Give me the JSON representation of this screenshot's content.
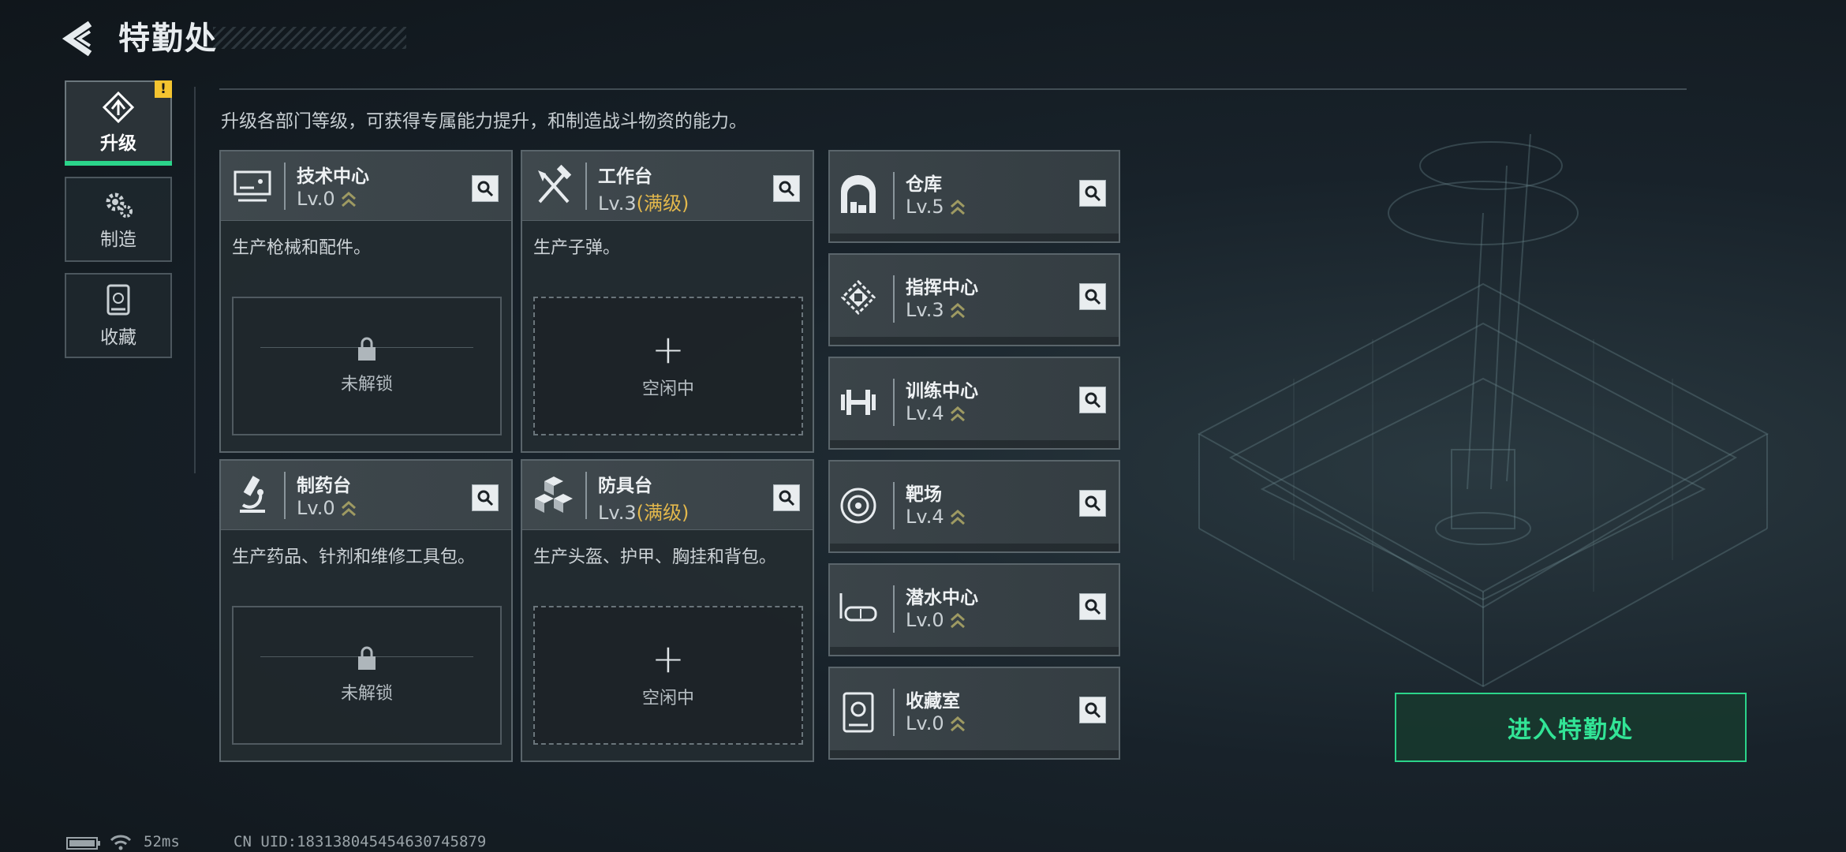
{
  "header": {
    "title": "特勤处"
  },
  "sidebar": {
    "items": [
      {
        "label": "升级",
        "active": true,
        "badge": "!"
      },
      {
        "label": "制造",
        "active": false
      },
      {
        "label": "收藏",
        "active": false
      }
    ]
  },
  "description": "升级各部门等级，可获得专属能力提升，和制造战斗物资的能力。",
  "stations": [
    {
      "name": "技术中心",
      "level": "Lv.0",
      "max": "",
      "icon": "monitor-icon",
      "desc": "生产枪械和配件。",
      "slot_status": "未解锁",
      "slot_state": "locked"
    },
    {
      "name": "工作台",
      "level": "Lv.3",
      "max": "(满级)",
      "icon": "tools-icon",
      "desc": "生产子弹。",
      "slot_status": "空闲中",
      "slot_state": "idle"
    },
    {
      "name": "制药台",
      "level": "Lv.0",
      "max": "",
      "icon": "microscope-icon",
      "desc": "生产药品、针剂和维修工具包。",
      "slot_status": "未解锁",
      "slot_state": "locked"
    },
    {
      "name": "防具台",
      "level": "Lv.3",
      "max": "(满级)",
      "icon": "armor-blocks-icon",
      "desc": "生产头盔、护甲、胸挂和背包。",
      "slot_status": "空闲中",
      "slot_state": "idle"
    }
  ],
  "facilities": [
    {
      "name": "仓库",
      "level": "Lv.5",
      "icon": "warehouse-icon"
    },
    {
      "name": "指挥中心",
      "level": "Lv.3",
      "icon": "chip-icon"
    },
    {
      "name": "训练中心",
      "level": "Lv.4",
      "icon": "dumbbell-icon"
    },
    {
      "name": "靶场",
      "level": "Lv.4",
      "icon": "target-icon"
    },
    {
      "name": "潜水中心",
      "level": "Lv.0",
      "icon": "diving-mask-icon"
    },
    {
      "name": "收藏室",
      "level": "Lv.0",
      "icon": "collection-icon"
    }
  ],
  "enter_button": "进入特勤处",
  "status_bar": {
    "ping": "52ms",
    "uid": "CN UID:18313804545463074587​9"
  },
  "colors": {
    "accent": "#2bd48a",
    "max_level": "#e3b84c",
    "badge": "#f4c430"
  }
}
